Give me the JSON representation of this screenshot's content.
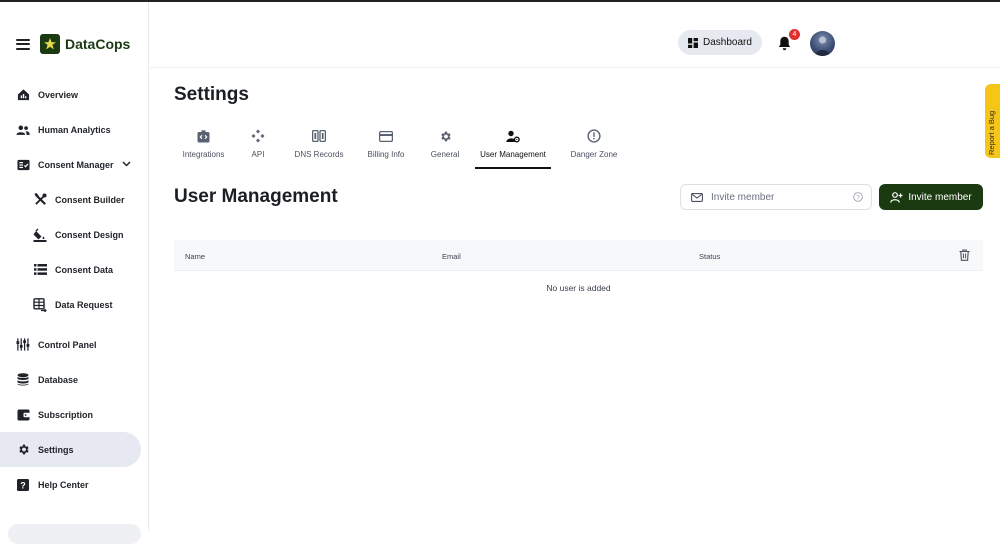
{
  "app": {
    "name": "DataCops"
  },
  "sidebar": {
    "items": [
      {
        "label": "Overview",
        "icon": "home-analytics-icon"
      },
      {
        "label": "Human Analytics",
        "icon": "users-icon"
      },
      {
        "label": "Consent Manager",
        "icon": "checklist-icon"
      },
      {
        "label": "Consent Builder",
        "icon": "tools-icon"
      },
      {
        "label": "Consent Design",
        "icon": "paint-bucket-icon"
      },
      {
        "label": "Consent Data",
        "icon": "list-icon"
      },
      {
        "label": "Data Request",
        "icon": "table-arrow-icon"
      },
      {
        "label": "Control Panel",
        "icon": "sliders-icon"
      },
      {
        "label": "Database",
        "icon": "database-icon"
      },
      {
        "label": "Subscription",
        "icon": "wallet-icon"
      },
      {
        "label": "Settings",
        "icon": "gear-icon"
      },
      {
        "label": "Help Center",
        "icon": "help-icon"
      }
    ],
    "active": "Settings"
  },
  "header": {
    "dashboard_label": "Dashboard",
    "notification_count": "4"
  },
  "page": {
    "title": "Settings"
  },
  "tabs": [
    {
      "label": "Integrations",
      "icon": "integrations-icon"
    },
    {
      "label": "API",
      "icon": "api-icon"
    },
    {
      "label": "DNS Records",
      "icon": "dns-icon"
    },
    {
      "label": "Billing Info",
      "icon": "credit-card-icon"
    },
    {
      "label": "General",
      "icon": "gear-icon"
    },
    {
      "label": "User Management",
      "icon": "user-gear-icon"
    },
    {
      "label": "Danger Zone",
      "icon": "alert-circle-icon"
    }
  ],
  "active_tab": "User Management",
  "user_management": {
    "title": "User Management",
    "invite_placeholder": "Invite member",
    "invite_button": "Invite member",
    "columns": [
      "Name",
      "Email",
      "Status"
    ],
    "empty_message": "No user is added"
  },
  "report_bug": "Report a Bug",
  "colors": {
    "brand": "#1b3a12",
    "active_nav": "#e6e9f1",
    "badge": "#e03131",
    "bug_tab": "#f5c518"
  }
}
